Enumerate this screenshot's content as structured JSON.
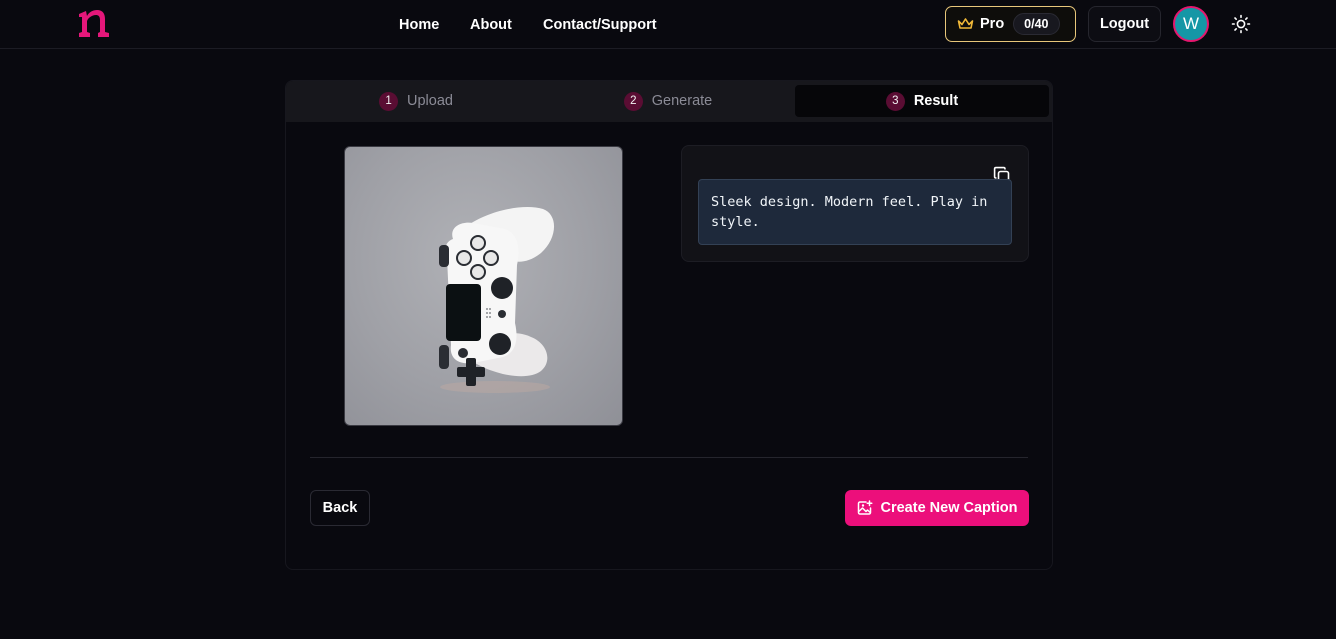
{
  "header": {
    "logo_letter": "n",
    "nav": [
      {
        "label": "Home"
      },
      {
        "label": "About"
      },
      {
        "label": "Contact/Support"
      }
    ],
    "pro": {
      "label": "Pro",
      "count": "0/40",
      "icon": "crown-icon"
    },
    "logout_label": "Logout",
    "avatar_initial": "W",
    "theme_icon": "sun-icon"
  },
  "stepper": {
    "steps": [
      {
        "number": "1",
        "label": "Upload"
      },
      {
        "number": "2",
        "label": "Generate"
      },
      {
        "number": "3",
        "label": "Result",
        "active": true
      }
    ]
  },
  "result": {
    "image_subject": "white game controller",
    "caption": "Sleek design. Modern feel. Play in style.",
    "copy_icon": "copy-icon"
  },
  "actions": {
    "back_label": "Back",
    "create_label": "Create New Caption",
    "create_icon": "image-plus-icon"
  },
  "colors": {
    "accent": "#ec0f7b",
    "pro_border": "#e8c77b",
    "avatar_bg": "#1597a6",
    "caption_bg": "#1e293b",
    "page_bg": "#09090f"
  }
}
